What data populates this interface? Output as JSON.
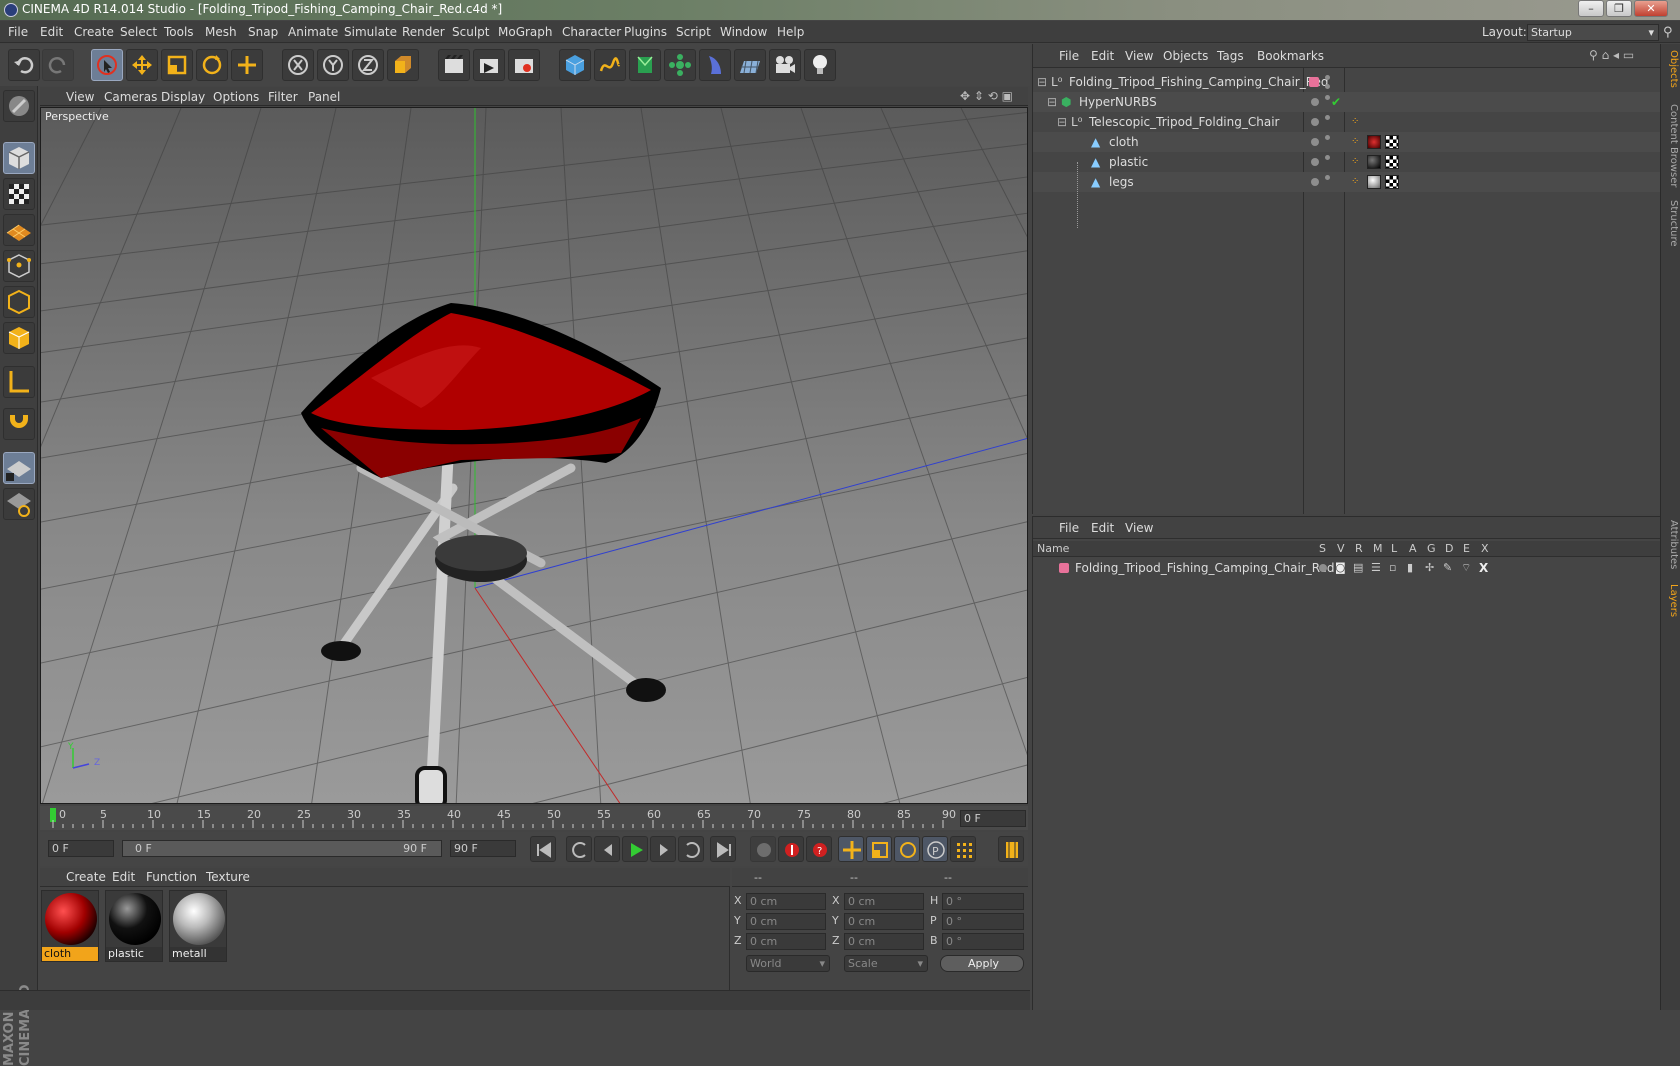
{
  "title": "CINEMA 4D R14.014 Studio - [Folding_Tripod_Fishing_Camping_Chair_Red.c4d *]",
  "menu": [
    "File",
    "Edit",
    "Create",
    "Select",
    "Tools",
    "Mesh",
    "Snap",
    "Animate",
    "Simulate",
    "Render",
    "Sculpt",
    "MoGraph",
    "Character",
    "Plugins",
    "Script",
    "Window",
    "Help"
  ],
  "layout": {
    "label": "Layout:",
    "value": "Startup"
  },
  "viewport": {
    "menu": [
      "View",
      "Cameras",
      "Display",
      "Options",
      "Filter",
      "Panel"
    ],
    "label": "Perspective",
    "axes": {
      "y": "Y",
      "z": "Z"
    }
  },
  "timeline": {
    "ticks": [
      "0",
      "5",
      "10",
      "15",
      "20",
      "25",
      "30",
      "35",
      "40",
      "45",
      "50",
      "55",
      "60",
      "65",
      "70",
      "75",
      "80",
      "85",
      "90"
    ],
    "current_frame": "0 F",
    "start": "0 F",
    "range_start": "0 F",
    "range_end": "90 F",
    "end": "90 F"
  },
  "material_panel": {
    "menu": [
      "Create",
      "Edit",
      "Function",
      "Texture"
    ],
    "materials": [
      {
        "name": "cloth",
        "active": true
      },
      {
        "name": "plastic",
        "active": false
      },
      {
        "name": "metall",
        "active": false
      }
    ]
  },
  "coordinates": {
    "headers": [
      "--",
      "--",
      "--"
    ],
    "rows": [
      {
        "a": "X",
        "av": "0 cm",
        "b": "X",
        "bv": "0 cm",
        "c": "H",
        "cv": "0 °"
      },
      {
        "a": "Y",
        "av": "0 cm",
        "b": "Y",
        "bv": "0 cm",
        "c": "P",
        "cv": "0 °"
      },
      {
        "a": "Z",
        "av": "0 cm",
        "b": "Z",
        "bv": "0 cm",
        "c": "B",
        "cv": "0 °"
      }
    ],
    "mode": "World",
    "type": "Scale",
    "apply": "Apply"
  },
  "object_manager": {
    "menu": [
      "File",
      "Edit",
      "View",
      "Objects",
      "Tags",
      "Bookmarks"
    ],
    "objects": [
      {
        "name": "Folding_Tripod_Fishing_Camping_Chair_Red"
      },
      {
        "name": "HyperNURBS"
      },
      {
        "name": "Telescopic_Tripod_Folding_Chair"
      },
      {
        "name": "cloth"
      },
      {
        "name": "plastic"
      },
      {
        "name": "legs"
      }
    ]
  },
  "layer_manager": {
    "menu": [
      "File",
      "Edit",
      "View"
    ],
    "columns": [
      "Name",
      "S",
      "V",
      "R",
      "M",
      "L",
      "A",
      "G",
      "D",
      "E",
      "X"
    ],
    "layers": [
      {
        "name": "Folding_Tripod_Fishing_Camping_Chair_Red"
      }
    ]
  },
  "side_tabs": [
    "Objects",
    "Content Browser",
    "Structure",
    "Attributes",
    "Layers"
  ],
  "colors": {
    "accent": "#f2a41a",
    "layer": "#e8729a",
    "cloth": "#b00000"
  }
}
